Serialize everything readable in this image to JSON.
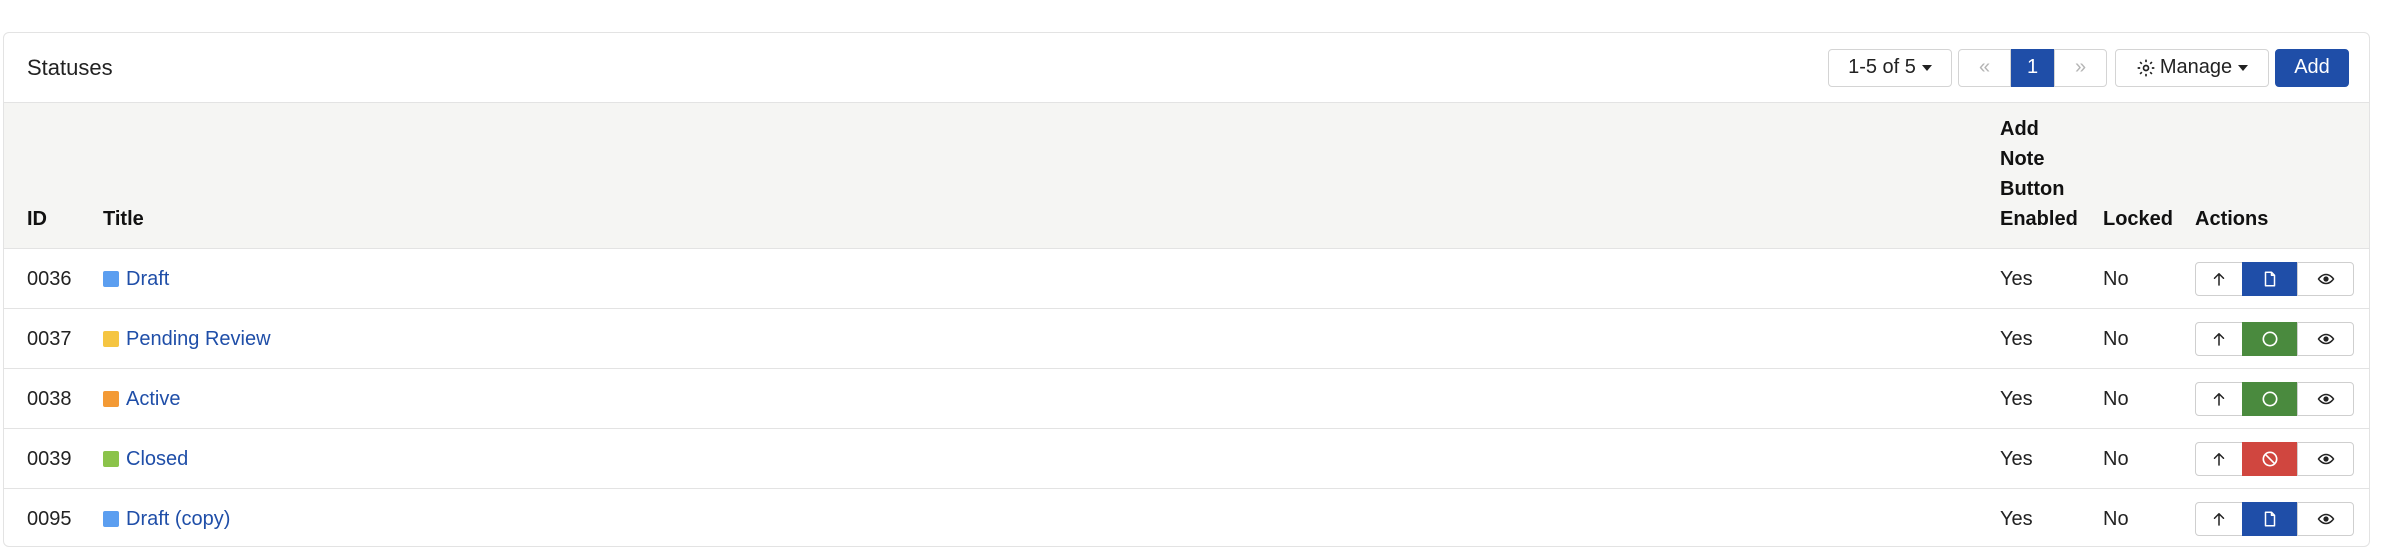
{
  "panel": {
    "title": "Statuses",
    "range_label": "1-5 of 5",
    "pagination": {
      "first": "«",
      "current": "1",
      "last": "»"
    },
    "manage_label": "Manage",
    "add_label": "Add"
  },
  "table": {
    "headers": {
      "id": "ID",
      "title": "Title",
      "add_note": [
        "Add",
        "Note",
        "Button",
        "Enabled"
      ],
      "locked": "Locked",
      "actions": "Actions"
    },
    "rows": [
      {
        "id": "0036",
        "title": "Draft",
        "color": "#5b9ef0",
        "add_note": "Yes",
        "locked": "No",
        "state_icon": "document-icon",
        "state_color": "#1f4ea8"
      },
      {
        "id": "0037",
        "title": "Pending Review",
        "color": "#f5c542",
        "add_note": "Yes",
        "locked": "No",
        "state_icon": "circle-icon",
        "state_color": "#4a8a3e"
      },
      {
        "id": "0038",
        "title": "Active",
        "color": "#f39a35",
        "add_note": "Yes",
        "locked": "No",
        "state_icon": "circle-icon",
        "state_color": "#4a8a3e"
      },
      {
        "id": "0039",
        "title": "Closed",
        "color": "#8bc34a",
        "add_note": "Yes",
        "locked": "No",
        "state_icon": "ban-icon",
        "state_color": "#d0463f"
      },
      {
        "id": "0095",
        "title": "Draft (copy)",
        "color": "#5b9ef0",
        "add_note": "Yes",
        "locked": "No",
        "state_icon": "document-icon",
        "state_color": "#1f4ea8"
      }
    ]
  }
}
